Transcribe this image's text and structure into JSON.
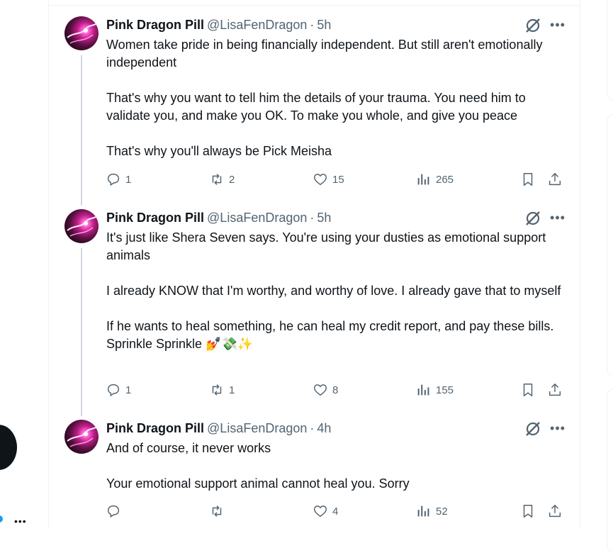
{
  "tweets": [
    {
      "name": "Pink Dragon Pill",
      "handle": "@LisaFenDragon",
      "separator": "·",
      "time": "5h",
      "paragraphs": [
        "Women take pride in being financially independent. But still aren't emotionally independent",
        "That's why you want to tell him the details of your trauma. You need him to validate you, and make you OK. To make you whole, and give you peace",
        "That's why you'll always be Pick Meisha"
      ],
      "replies": "1",
      "reposts": "2",
      "likes": "15",
      "views": "265"
    },
    {
      "name": "Pink Dragon Pill",
      "handle": "@LisaFenDragon",
      "separator": "·",
      "time": "5h",
      "paragraphs": [
        "It's just like Shera Seven says. You're using your dusties as emotional support animals",
        "I already KNOW that I'm worthy, and worthy of love. I already gave that to myself",
        "If he wants to heal something, he can heal my credit report, and pay these bills. Sprinkle Sprinkle 💅💸✨"
      ],
      "replies": "1",
      "reposts": "1",
      "likes": "8",
      "views": "155"
    },
    {
      "name": "Pink Dragon Pill",
      "handle": "@LisaFenDragon",
      "separator": "·",
      "time": "4h",
      "paragraphs": [
        "And of course, it never works",
        "Your emotional support animal cannot heal you. Sorry"
      ],
      "replies": "",
      "reposts": "",
      "likes": "4",
      "views": "52"
    }
  ],
  "more_label": "•••",
  "left_more_label": "•••",
  "icons": {
    "reply": "reply-icon",
    "repost": "repost-icon",
    "like": "heart-icon",
    "views": "views-icon",
    "bookmark": "bookmark-icon",
    "share": "share-icon",
    "grok": "grok-icon"
  }
}
